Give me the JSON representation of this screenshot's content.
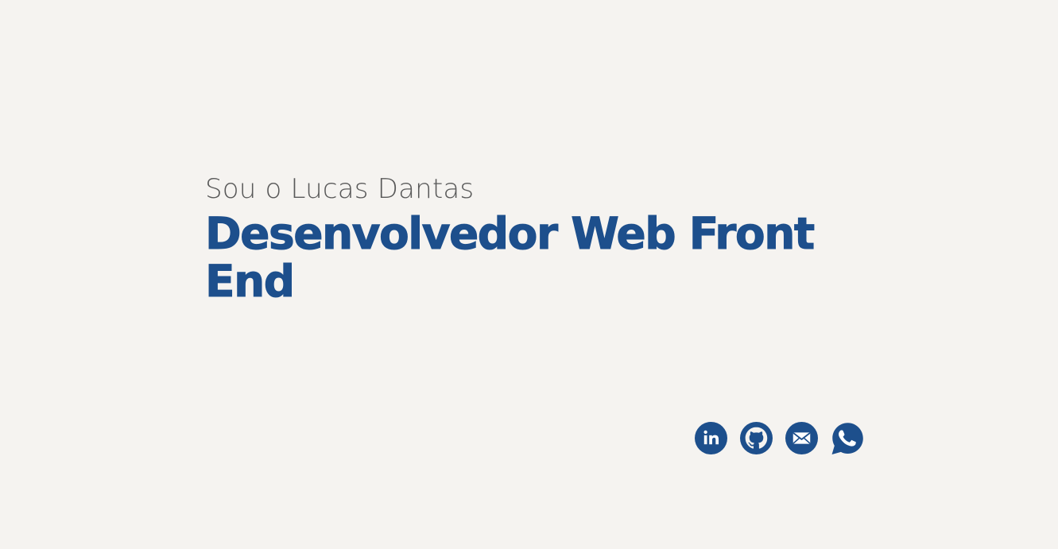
{
  "hero": {
    "intro": "Sou o Lucas Dantas",
    "title": "Desenvolvedor Web Front End"
  },
  "social": {
    "links": [
      {
        "icon": "linkedin-icon"
      },
      {
        "icon": "github-icon"
      },
      {
        "icon": "email-icon"
      },
      {
        "icon": "whatsapp-icon"
      }
    ]
  },
  "colors": {
    "background": "#f5f3f0",
    "accent": "#1d4f8c",
    "muted_text": "#595959"
  }
}
